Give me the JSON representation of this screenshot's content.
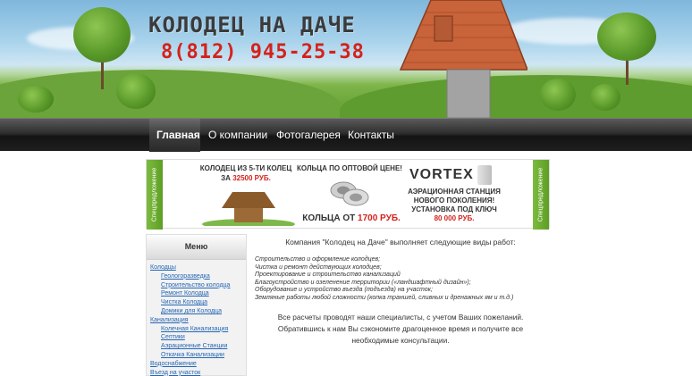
{
  "header": {
    "title": "КОЛОДЕЦ НА ДАЧЕ",
    "phone": "8(812) 945-25-38"
  },
  "nav": {
    "items": [
      {
        "label": "Главная",
        "active": true
      },
      {
        "label": "О компании",
        "active": false
      },
      {
        "label": "Фотогалерея",
        "active": false
      },
      {
        "label": "Контакты",
        "active": false
      }
    ]
  },
  "banner": {
    "side_tab_left": "Спецпредложение",
    "side_tab_right": "Спецпредложение",
    "offer1_line1": "КОЛОДЕЦ ИЗ 5-ТИ КОЛЕЦ",
    "offer1_prefix": "ЗА",
    "offer1_price": "32500 РУБ.",
    "offer2_title": "КОЛЬЦА ПО ОПТОВОЙ ЦЕНЕ!",
    "offer2_prefix": "КОЛЬЦА ОТ",
    "offer2_price": "1700 РУБ.",
    "brand": "VORTEX",
    "offer3_line1": "АЭРАЦИОННАЯ СТАНЦИЯ",
    "offer3_line2": "НОВОГО ПОКОЛЕНИЯ!",
    "offer3_line3": "УСТАНОВКА ПОД КЛЮЧ",
    "offer3_price": "80 000 РУБ."
  },
  "sidebar": {
    "title": "Меню",
    "items": [
      {
        "label": "Колодцы",
        "level": 1
      },
      {
        "label": "Геологоразведка",
        "level": 2
      },
      {
        "label": "Строительство колодца",
        "level": 2
      },
      {
        "label": "Ремонт Колодца",
        "level": 2
      },
      {
        "label": "Чистка Колодца",
        "level": 2
      },
      {
        "label": "Домики для Колодца",
        "level": 2
      },
      {
        "label": "Канализация",
        "level": 1
      },
      {
        "label": "Колечная Канализация",
        "level": 2
      },
      {
        "label": "Септики",
        "level": 2
      },
      {
        "label": "Аэрационные Станции",
        "level": 2
      },
      {
        "label": "Откачка Канализации",
        "level": 2
      },
      {
        "label": "Водоснабжение",
        "level": 1
      },
      {
        "label": "Въезд на участок",
        "level": 1
      }
    ]
  },
  "content": {
    "intro": "Компания \"Колодец на Даче\" выполняет следующие виды работ:",
    "services": [
      "Строительство и оформление колодцев;",
      "Чистка и ремонт действующих колодцев;",
      "Проектирование и строительство канализаций",
      "Благоустройство и озеленение территории («ландшафтный дизайн»);",
      "Оборудование и устройство въезда (подъезда) на участок;",
      "Земляные работы любой сложности (копка траншей, сливных и дренажных ям и т.д.)"
    ],
    "outro_line1": "Все расчеты проводят наши специалисты, с учетом Ваших пожеланий.",
    "outro_line2": "Обратившись к нам Вы сэкономите драгоценное время и получите все",
    "outro_line3": "необходимые консультации."
  },
  "colors": {
    "accent_red": "#d4221b",
    "link_blue": "#2566b5",
    "nav_dark": "#1e1e1e",
    "promo_green": "#6fae33"
  }
}
